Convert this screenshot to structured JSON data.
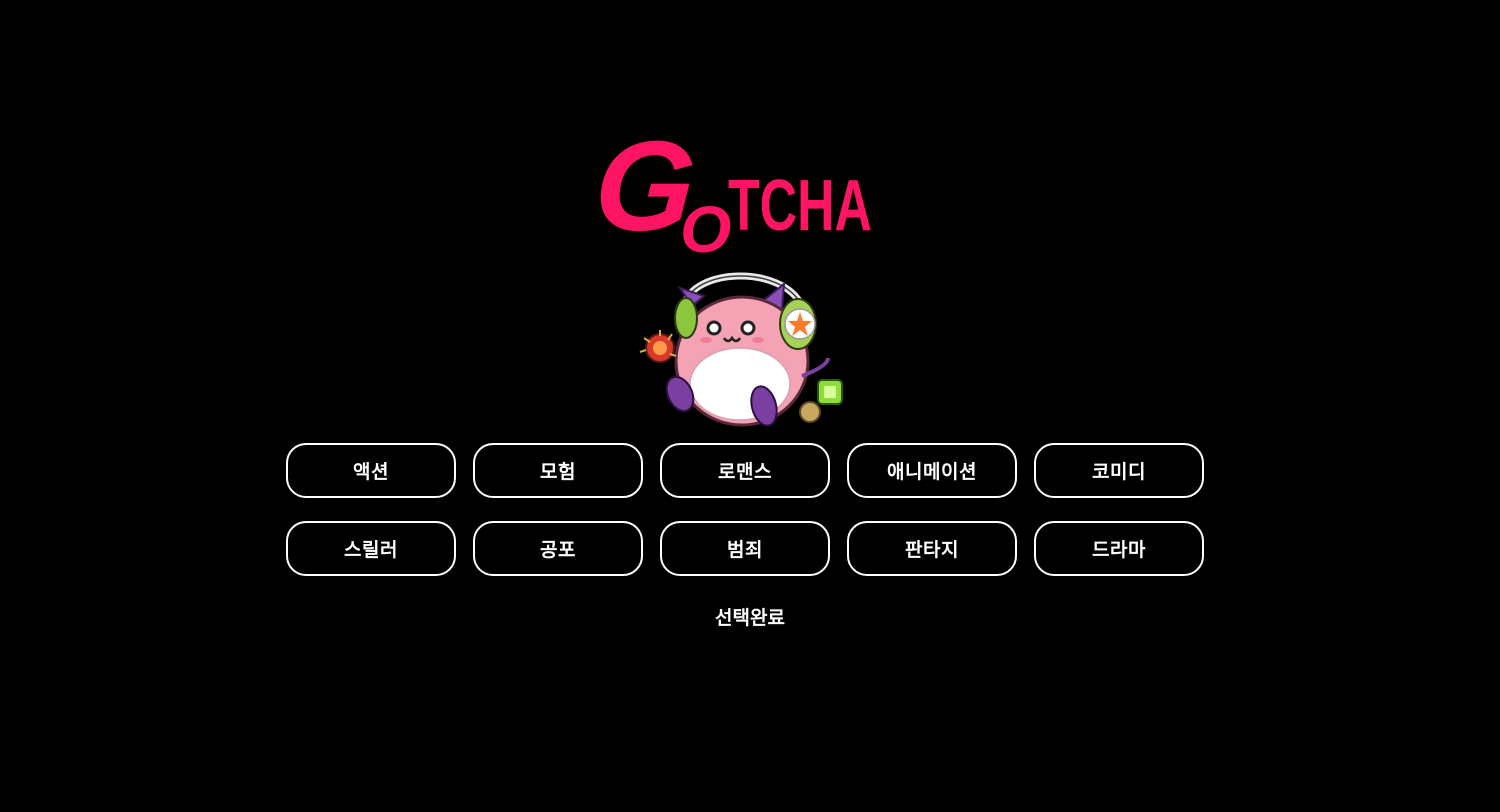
{
  "logo": {
    "text_big_g": "G",
    "text_small_o": "O",
    "text_rest": "TCHA",
    "brand_color": "#ff1464"
  },
  "mascot": {
    "icon": "pink-bean-mascot-with-headphones"
  },
  "genres": [
    {
      "label": "액션"
    },
    {
      "label": "모험"
    },
    {
      "label": "로맨스"
    },
    {
      "label": "애니메이션"
    },
    {
      "label": "코미디"
    },
    {
      "label": "스릴러"
    },
    {
      "label": "공포"
    },
    {
      "label": "범죄"
    },
    {
      "label": "판타지"
    },
    {
      "label": "드라마"
    }
  ],
  "done_label": "선택완료",
  "colors": {
    "background": "#000000",
    "button_border": "#ffffff",
    "text": "#ffffff"
  }
}
